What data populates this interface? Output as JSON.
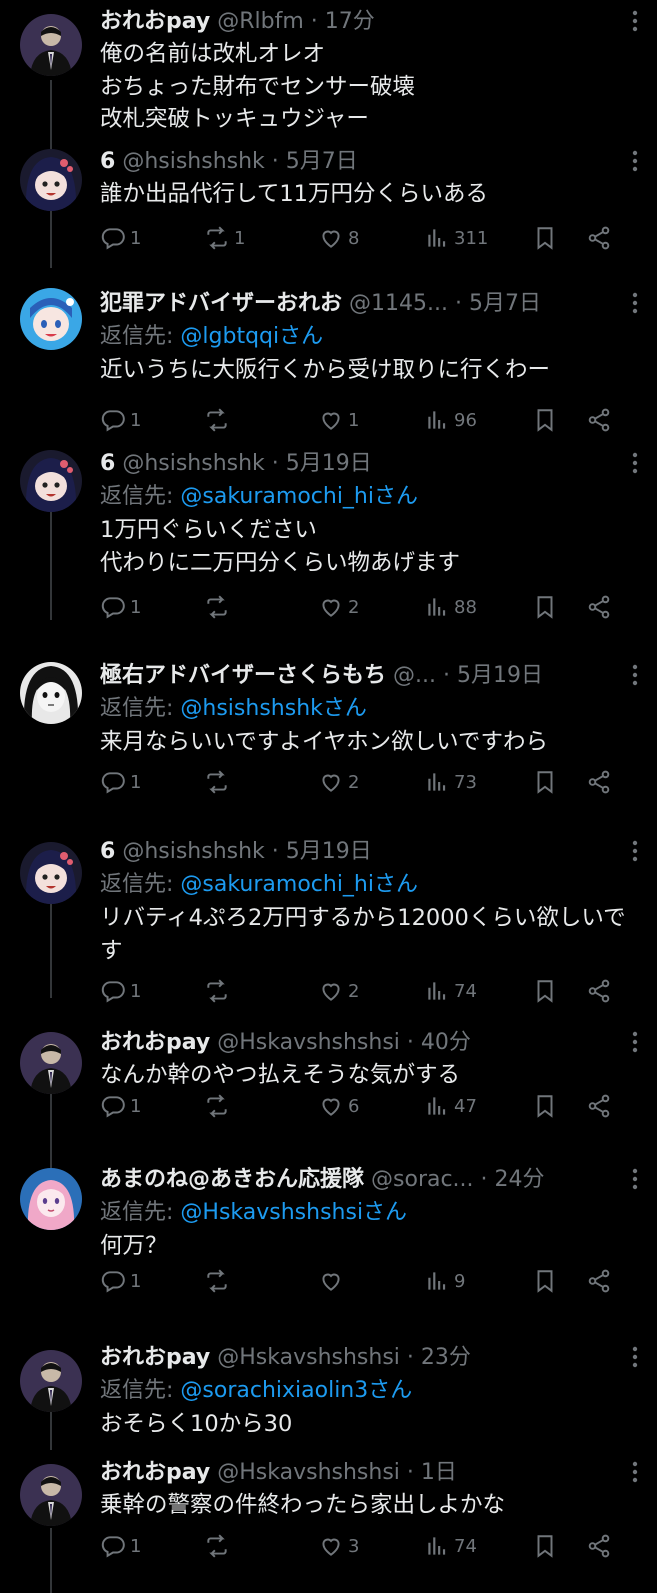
{
  "posts": [
    {
      "name": "おれおpay",
      "handle": "@Rlbfm",
      "time": "17分",
      "reply_to": "",
      "text": "俺の名前は改札オレオ\nおちょった財布でセンサー破壊\n改札突破トッキュウジャー",
      "stats": null,
      "avatar": "avatar-suit-person"
    },
    {
      "name": "6",
      "handle": "@hsishshshk",
      "time": "5月7日",
      "reply_to": "",
      "text": "誰か出品代行して11万円分くらいある",
      "stats": {
        "replies": "1",
        "reposts": "1",
        "likes": "8",
        "views": "311"
      },
      "avatar": "avatar-anime-girl-dark"
    },
    {
      "name": "犯罪アドバイザーおれお",
      "handle": "@1145...",
      "time": "5月7日",
      "reply_to": "@lgbtqqiさん",
      "text": "近いうちに大阪行くから受け取りに行くわー",
      "stats": {
        "replies": "1",
        "reposts": "",
        "likes": "1",
        "views": "96"
      },
      "avatar": "avatar-anime-blue"
    },
    {
      "name": "6",
      "handle": "@hsishshshk",
      "time": "5月19日",
      "reply_to": "@sakuramochi_hiさん",
      "text": "1万円ぐらいください\n代わりに二万円分くらい物あげます",
      "stats": {
        "replies": "1",
        "reposts": "",
        "likes": "2",
        "views": "88"
      },
      "avatar": "avatar-anime-girl-dark"
    },
    {
      "name": "極右アドバイザーさくらもち",
      "handle": "@...",
      "time": "5月19日",
      "reply_to": "@hsishshshkさん",
      "text": "来月ならいいですよイヤホン欲しいですわら",
      "stats": {
        "replies": "1",
        "reposts": "",
        "likes": "2",
        "views": "73"
      },
      "avatar": "avatar-monochrome-girl"
    },
    {
      "name": "6",
      "handle": "@hsishshshk",
      "time": "5月19日",
      "reply_to": "@sakuramochi_hiさん",
      "text": "リバティ4ぷろ2万円するから12000くらい欲しいです",
      "stats": {
        "replies": "1",
        "reposts": "",
        "likes": "2",
        "views": "74"
      },
      "avatar": "avatar-anime-girl-dark"
    },
    {
      "name": "おれおpay",
      "handle": "@Hskavshshshsi",
      "time": "40分",
      "reply_to": "",
      "text": "なんか幹のやつ払えそうな気がする",
      "stats": {
        "replies": "1",
        "reposts": "",
        "likes": "6",
        "views": "47"
      },
      "avatar": "avatar-suit-person"
    },
    {
      "name": "あまのね@あきおん応援隊",
      "handle": "@sorac...",
      "time": "24分",
      "reply_to": "@Hskavshshshsiさん",
      "text": "何万？",
      "stats": {
        "replies": "1",
        "reposts": "",
        "likes": "",
        "views": "9"
      },
      "avatar": "avatar-anime-pink"
    },
    {
      "name": "おれおpay",
      "handle": "@Hskavshshshsi",
      "time": "23分",
      "reply_to": "@sorachixiaolin3さん",
      "text": "おそらく10から30",
      "stats": null,
      "avatar": "avatar-suit-person"
    },
    {
      "name": "おれおpay",
      "handle": "@Hskavshshshsi",
      "time": "1日",
      "reply_to": "",
      "text": "乗幹の警察の件終わったら家出しよかな",
      "stats": {
        "replies": "1",
        "reposts": "",
        "likes": "3",
        "views": "74"
      },
      "avatar": "avatar-suit-person"
    }
  ],
  "labels": {
    "reply_prefix": "返信先: ",
    "dot": " · "
  },
  "colors": {
    "background": "#000000",
    "text": "#e7e9ea",
    "secondary": "#71767b",
    "link": "#1d9bf0",
    "thread_line": "#333639"
  }
}
